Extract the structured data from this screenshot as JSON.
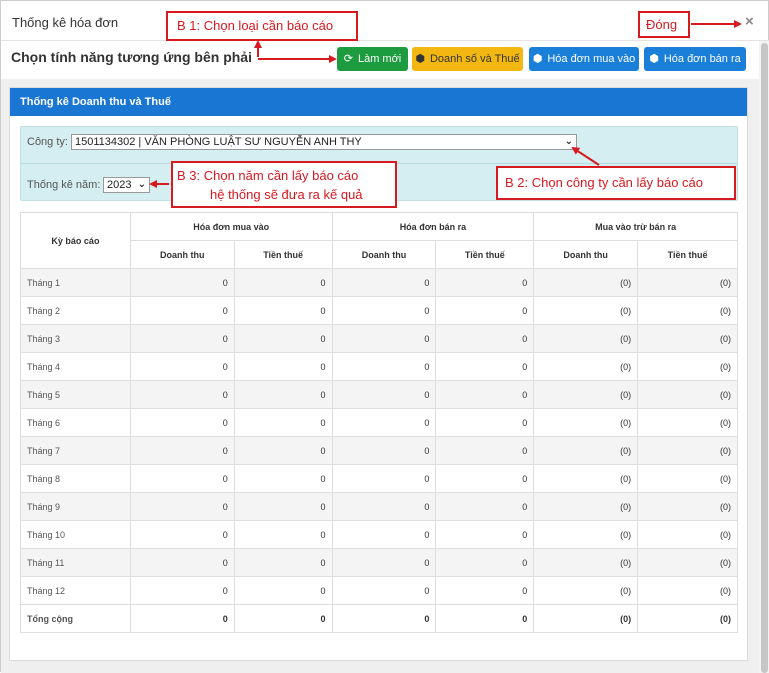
{
  "window": {
    "title": "Thống kê hóa đơn",
    "close_icon": "×"
  },
  "subheading": "Chọn tính năng tương ứng bên phải",
  "toolbar": {
    "refresh": {
      "icon": "⟳",
      "label": "Làm mới"
    },
    "revenue_tax": {
      "icon": "⬢",
      "label": "Doanh số và Thuế"
    },
    "purchase_invoices": {
      "icon": "⬢",
      "label": "Hóa đơn mua vào"
    },
    "sales_invoices": {
      "icon": "⬢",
      "label": "Hóa đơn bán ra"
    }
  },
  "panel": {
    "title": "Thống kê Doanh thu và Thuế"
  },
  "filters": {
    "company_label": "Công ty:",
    "company_value": "1501134302 | VĂN PHÒNG LUẬT SƯ NGUYỄN ANH THY",
    "year_label": "Thống kê năm:",
    "year_value": "2023"
  },
  "table": {
    "period_header": "Kỳ báo cáo",
    "groups": [
      "Hóa đơn mua vào",
      "Hóa đơn bán ra",
      "Mua vào trừ bán ra"
    ],
    "sub_headers": [
      "Doanh thu",
      "Tiền thuế",
      "Doanh thu",
      "Tiền thuế",
      "Doanh thu",
      "Tiền thuế"
    ],
    "rows": [
      {
        "label": "Tháng 1",
        "values": [
          "0",
          "0",
          "0",
          "0",
          "(0)",
          "(0)"
        ]
      },
      {
        "label": "Tháng 2",
        "values": [
          "0",
          "0",
          "0",
          "0",
          "(0)",
          "(0)"
        ]
      },
      {
        "label": "Tháng 3",
        "values": [
          "0",
          "0",
          "0",
          "0",
          "(0)",
          "(0)"
        ]
      },
      {
        "label": "Tháng 4",
        "values": [
          "0",
          "0",
          "0",
          "0",
          "(0)",
          "(0)"
        ]
      },
      {
        "label": "Tháng 5",
        "values": [
          "0",
          "0",
          "0",
          "0",
          "(0)",
          "(0)"
        ]
      },
      {
        "label": "Tháng 6",
        "values": [
          "0",
          "0",
          "0",
          "0",
          "(0)",
          "(0)"
        ]
      },
      {
        "label": "Tháng 7",
        "values": [
          "0",
          "0",
          "0",
          "0",
          "(0)",
          "(0)"
        ]
      },
      {
        "label": "Tháng 8",
        "values": [
          "0",
          "0",
          "0",
          "0",
          "(0)",
          "(0)"
        ]
      },
      {
        "label": "Tháng 9",
        "values": [
          "0",
          "0",
          "0",
          "0",
          "(0)",
          "(0)"
        ]
      },
      {
        "label": "Tháng 10",
        "values": [
          "0",
          "0",
          "0",
          "0",
          "(0)",
          "(0)"
        ]
      },
      {
        "label": "Tháng 11",
        "values": [
          "0",
          "0",
          "0",
          "0",
          "(0)",
          "(0)"
        ]
      },
      {
        "label": "Tháng 12",
        "values": [
          "0",
          "0",
          "0",
          "0",
          "(0)",
          "(0)"
        ]
      }
    ],
    "total": {
      "label": "Tổng cộng",
      "values": [
        "0",
        "0",
        "0",
        "0",
        "(0)",
        "(0)"
      ]
    }
  },
  "annotations": {
    "step1": "B 1: Chọn loại cần báo cáo",
    "close": "Đóng",
    "step2": "B 2: Chọn công ty cần lấy báo cáo",
    "step3_line1": "B 3: Chọn năm cần lấy báo cáo",
    "step3_line2": "hệ thống sẽ đưa ra kế quả"
  },
  "colors": {
    "accent": "#1976d2",
    "green": "#1d9b3f",
    "yellow": "#f2b711",
    "annotation": "#d71920"
  }
}
